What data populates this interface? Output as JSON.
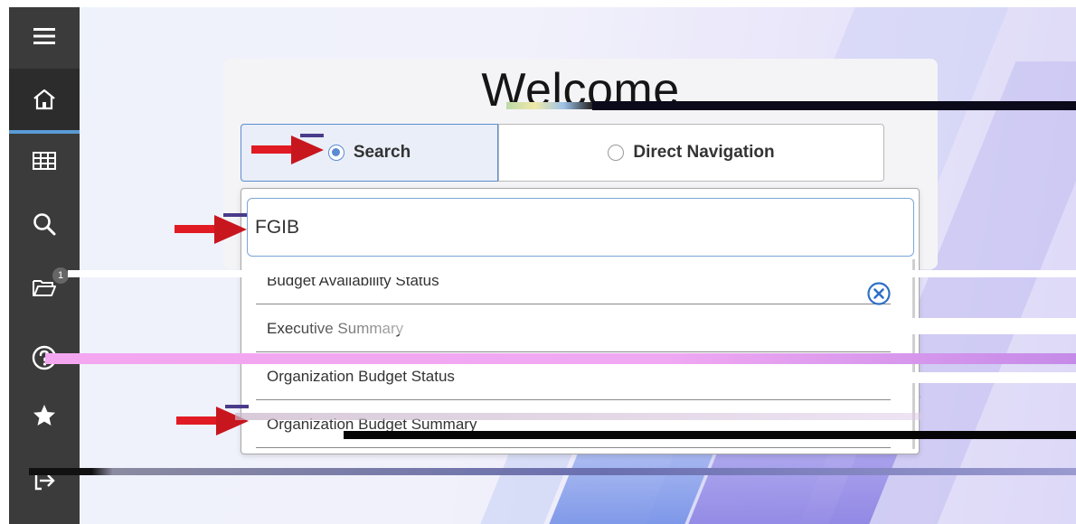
{
  "sidebar": {
    "items": [
      {
        "icon": "menu-icon"
      },
      {
        "icon": "home-icon",
        "active": true
      },
      {
        "icon": "grid-icon"
      },
      {
        "icon": "search-icon"
      },
      {
        "icon": "folder-open-icon",
        "badge": "1"
      },
      {
        "icon": "help-icon"
      },
      {
        "icon": "star-icon"
      },
      {
        "icon": "sign-out-icon"
      }
    ]
  },
  "main": {
    "title": "Welcome",
    "mode_search_label": "Search",
    "mode_direct_label": "Direct Navigation",
    "search_value": "FGIB",
    "results": [
      "Budget Availability Status",
      "Executive Summary",
      "Organization Budget Status",
      "Organization Budget Summary"
    ]
  },
  "colors": {
    "sidebar": "#3b3b3b",
    "accent": "#5b8bd0",
    "arrow": "#e01b24"
  }
}
